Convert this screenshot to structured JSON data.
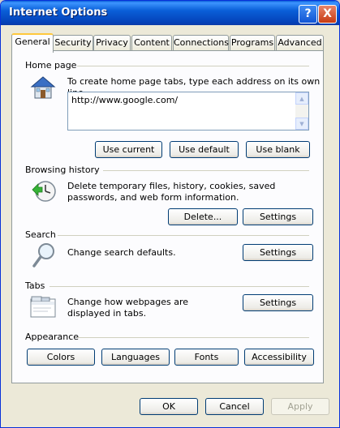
{
  "window": {
    "title": "Internet Options",
    "help_label": "?",
    "close_label": "X"
  },
  "tabs": [
    {
      "label": "General"
    },
    {
      "label": "Security"
    },
    {
      "label": "Privacy"
    },
    {
      "label": "Content"
    },
    {
      "label": "Connections"
    },
    {
      "label": "Programs"
    },
    {
      "label": "Advanced"
    }
  ],
  "home_page": {
    "section_label": "Home page",
    "description": "To create home page tabs, type each address on its own line.",
    "url_value": "http://www.google.com/",
    "buttons": {
      "use_current": "Use current",
      "use_default": "Use default",
      "use_blank": "Use blank"
    }
  },
  "browsing_history": {
    "section_label": "Browsing history",
    "description": "Delete temporary files, history, cookies, saved passwords, and web form information.",
    "buttons": {
      "delete": "Delete...",
      "settings": "Settings"
    }
  },
  "search": {
    "section_label": "Search",
    "description": "Change search defaults.",
    "buttons": {
      "settings": "Settings"
    }
  },
  "tabs_section": {
    "section_label": "Tabs",
    "description": "Change how webpages are displayed in tabs.",
    "buttons": {
      "settings": "Settings"
    }
  },
  "appearance": {
    "section_label": "Appearance",
    "buttons": {
      "colors": "Colors",
      "languages": "Languages",
      "fonts": "Fonts",
      "accessibility": "Accessibility"
    }
  },
  "footer": {
    "ok": "OK",
    "cancel": "Cancel",
    "apply": "Apply",
    "apply_enabled": false
  },
  "icons": {
    "home": "house-icon",
    "history": "history-clock-icon",
    "search": "magnifier-icon",
    "tabs": "tabs-window-icon"
  }
}
